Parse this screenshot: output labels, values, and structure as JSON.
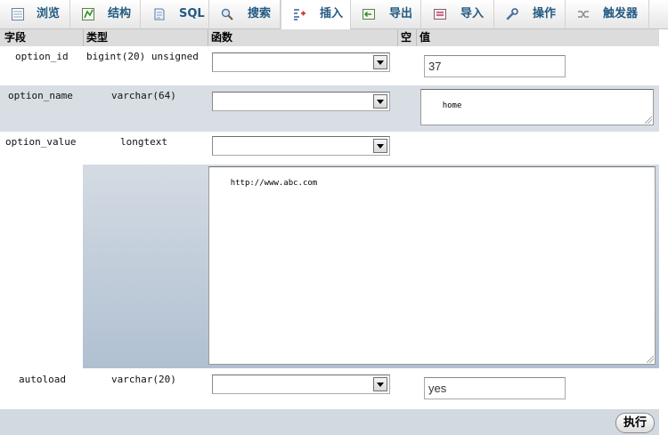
{
  "tabs": [
    {
      "label": "浏览",
      "icon": "browse-icon"
    },
    {
      "label": "结构",
      "icon": "structure-icon"
    },
    {
      "label": "SQL",
      "icon": "sql-icon"
    },
    {
      "label": "搜索",
      "icon": "search-icon"
    },
    {
      "label": "插入",
      "icon": "insert-icon",
      "active": true
    },
    {
      "label": "导出",
      "icon": "export-icon"
    },
    {
      "label": "导入",
      "icon": "import-icon"
    },
    {
      "label": "操作",
      "icon": "operations-icon"
    },
    {
      "label": "触发器",
      "icon": "triggers-icon"
    }
  ],
  "table_header": {
    "field": "字段",
    "type": "类型",
    "function": "函数",
    "null": "空",
    "value": "值"
  },
  "rows": [
    {
      "field": "option_id",
      "type": "bigint(20) unsigned",
      "function": "",
      "value": "37"
    },
    {
      "field": "option_name",
      "type": "varchar(64)",
      "function": "",
      "value": "home"
    },
    {
      "field": "option_value",
      "type": "longtext",
      "function": "",
      "value": "http://www.abc.com"
    },
    {
      "field": "autoload",
      "type": "varchar(20)",
      "function": "",
      "value": "yes"
    }
  ],
  "footer": {
    "go_label": "执行"
  },
  "colors": {
    "tab_text": "#235a81",
    "header_bg": "#dcdcdc",
    "row_alt_bg": "#d9dee5",
    "gradient_top": "#d4dbe3",
    "gradient_bottom": "#b0c0d2"
  }
}
